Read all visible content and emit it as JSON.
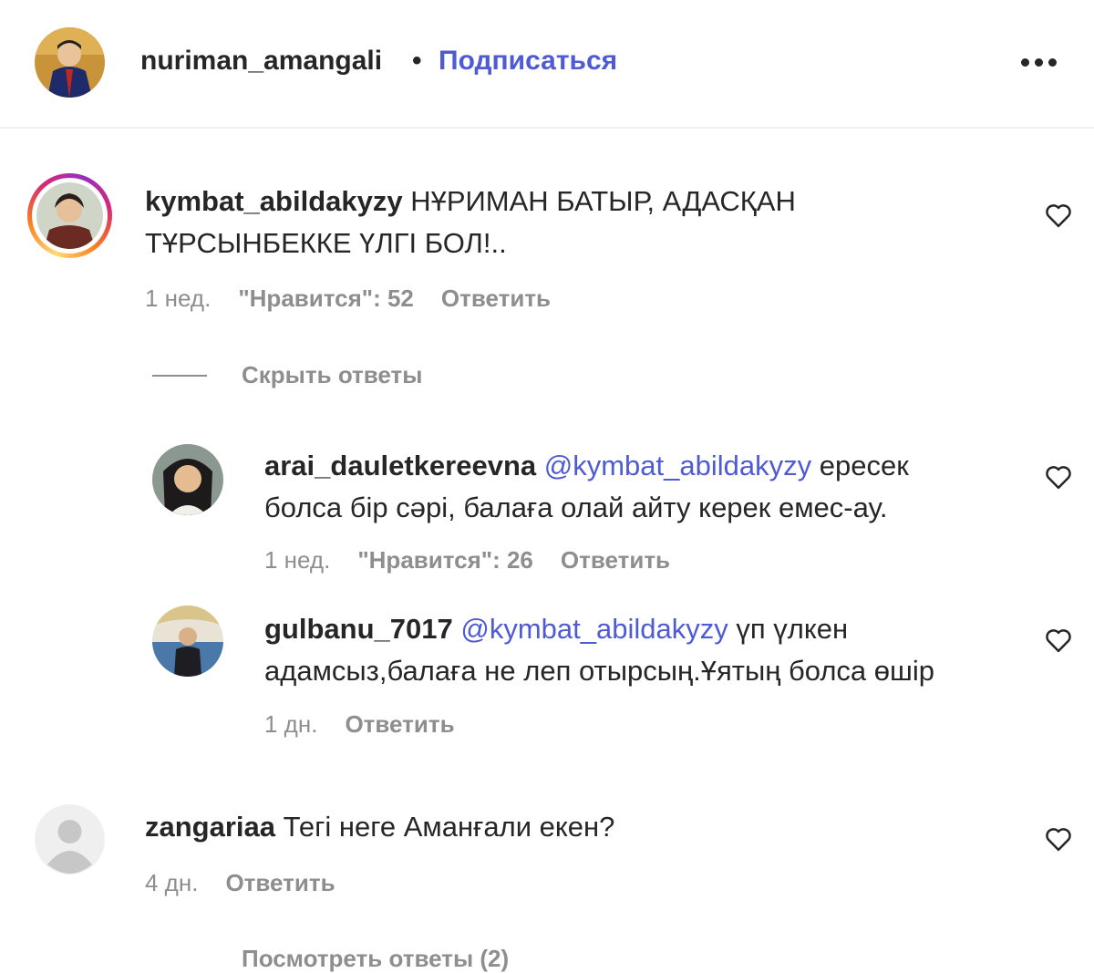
{
  "header": {
    "username": "nuriman_amangali",
    "separator": "•",
    "follow_label": "Подписаться",
    "more_icon": "more-horizontal-icon"
  },
  "comments": [
    {
      "username": "kymbat_abildakyzy",
      "text": "НҰРИМАН БАТЫР, АДАСҚАН ТҰРСЫНБЕККЕ ҮЛГІ БОЛ!..",
      "time": "1 нед.",
      "likes": "\"Нравится\": 52",
      "reply": "Ответить",
      "has_story_ring": true,
      "hide_replies": "Скрыть ответы",
      "replies": [
        {
          "username": "arai_dauletkereevna",
          "mention": "@kymbat_abildakyzy",
          "text": "ересек болса бір сәрі, балаға олай айту керек емес-ау.",
          "time": "1 нед.",
          "likes": "\"Нравится\": 26",
          "reply": "Ответить"
        },
        {
          "username": "gulbanu_7017",
          "mention": "@kymbat_abildakyzy",
          "text": "үп үлкен адамсыз,балаға не леп отырсың.Ұятың болса өшір",
          "time": "1 дн.",
          "reply": "Ответить"
        }
      ]
    },
    {
      "username": "zangariaa",
      "text": "Тегі неге Аманғали екен?",
      "time": "4 дн.",
      "reply": "Ответить",
      "more_replies_partial": "Посмотреть ответы (2)"
    }
  ],
  "icons": {
    "like": "heart-outline-icon",
    "default_avatar": "default-user-icon"
  },
  "colors": {
    "link": "#4f5bd5",
    "text": "#262626",
    "secondary": "#8e8e8e",
    "divider": "#efefef"
  }
}
